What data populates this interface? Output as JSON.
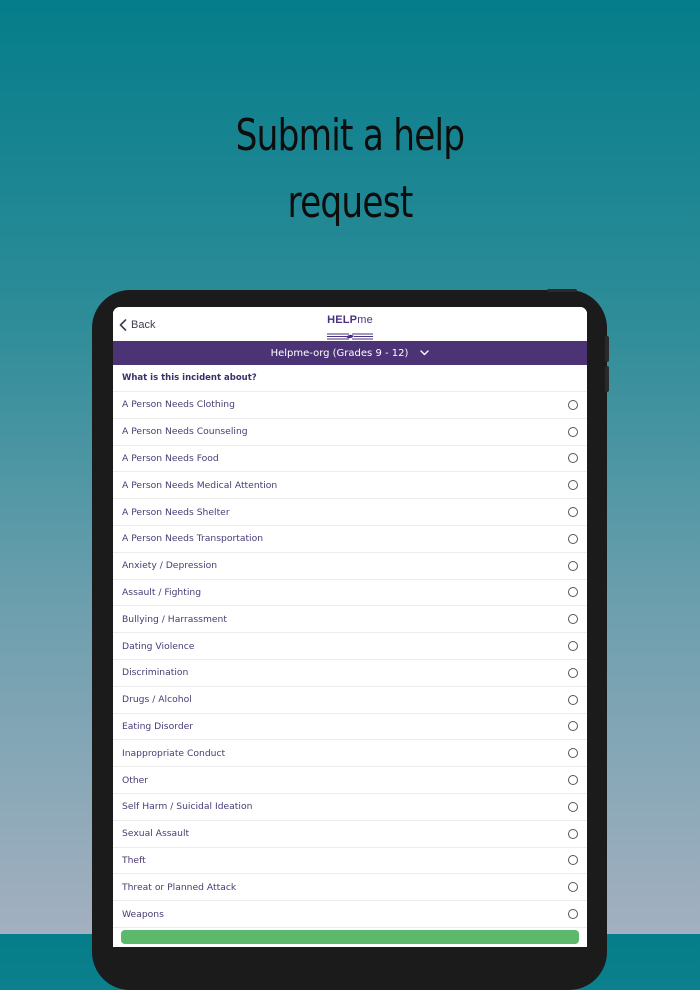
{
  "headline": {
    "line1": "Submit a help",
    "line2": "request"
  },
  "topbar": {
    "back_label": "Back",
    "logo_help": "HELP",
    "logo_me": "me"
  },
  "org_selector": {
    "label": "Helpme-org (Grades 9 - 12)"
  },
  "question": "What is this incident about?",
  "options": [
    "A Person Needs Clothing",
    "A Person Needs Counseling",
    "A Person Needs Food",
    "A Person Needs Medical Attention",
    "A Person Needs Shelter",
    "A Person Needs Transportation",
    "Anxiety / Depression",
    "Assault / Fighting",
    "Bullying / Harrassment",
    "Dating Violence",
    "Discrimination",
    "Drugs / Alcohol",
    "Eating Disorder",
    "Inappropriate Conduct",
    "Other",
    "Self Harm / Suicidal Ideation",
    "Sexual Assault",
    "Theft",
    "Threat or Planned Attack",
    "Weapons"
  ],
  "colors": {
    "brand_purple": "#4b3376",
    "accent_green": "#5cb86b"
  }
}
